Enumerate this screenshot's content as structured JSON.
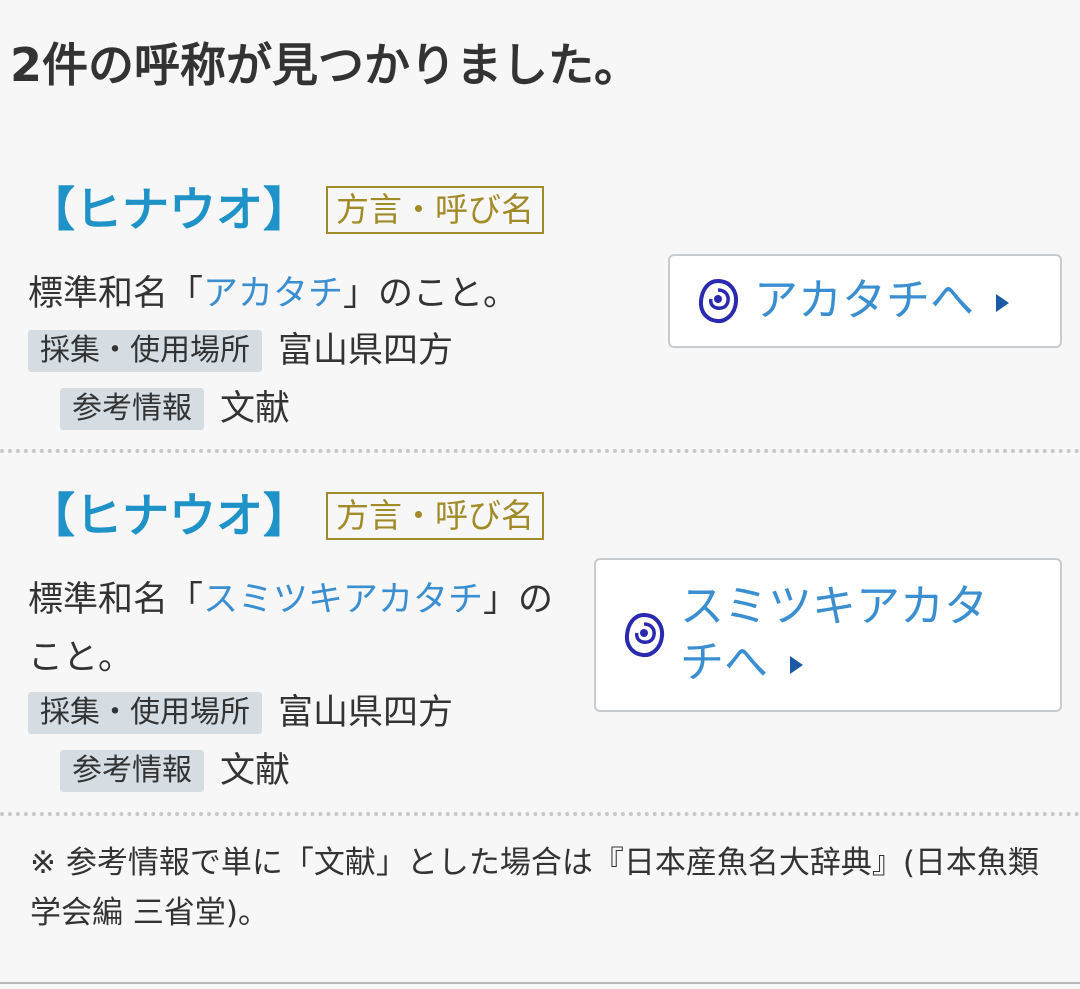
{
  "header": {
    "result_count": "2件の呼称が見つかりました。"
  },
  "entries": [
    {
      "name": "【ヒナウオ】",
      "type_badge": "方言・呼び名",
      "desc_prefix": "標準和名「",
      "desc_link": "アカタチ",
      "desc_suffix": "」のこと。",
      "place_label": "採集・使用場所",
      "place_value": "富山県四方",
      "ref_label": "参考情報",
      "ref_value": "文献",
      "goto_label": "アカタチへ",
      "goto_icon": "fish-icon"
    },
    {
      "name": "【ヒナウオ】",
      "type_badge": "方言・呼び名",
      "desc_prefix": "標準和名「",
      "desc_link": "スミツキアカタチ",
      "desc_suffix": "」のこと。",
      "place_label": "採集・使用場所",
      "place_value": "富山県四方",
      "ref_label": "参考情報",
      "ref_value": "文献",
      "goto_label": "スミツキアカタチへ",
      "goto_icon": "fish-icon"
    }
  ],
  "footnote": "※ 参考情報で単に「文献」とした場合は『日本産魚名大辞典』(日本魚類学会編 三省堂)。",
  "colors": {
    "link": "#3b8fd0",
    "name_title": "#1f92c7",
    "badge": "#a18a28",
    "label_bg": "#d5dde3",
    "arrow": "#1c5aa6",
    "icon": "#2a2ab0"
  }
}
